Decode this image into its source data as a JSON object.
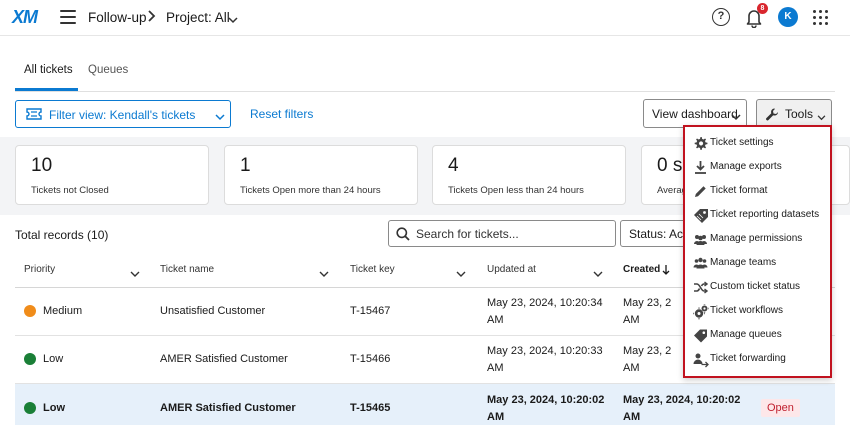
{
  "header": {
    "logo": "XM",
    "breadcrumb_app": "Follow-up",
    "breadcrumb_project": "Project: All",
    "notification_count": "8",
    "avatar_initial": "K"
  },
  "tabs": [
    {
      "label": "All tickets",
      "active": true
    },
    {
      "label": "Queues",
      "active": false
    }
  ],
  "filters": {
    "filter_view_label": "Filter view: Kendall's tickets",
    "reset_label": "Reset filters",
    "view_dashboard_label": "View dashboard",
    "tools_label": "Tools"
  },
  "stats": [
    {
      "value": "10",
      "label": "Tickets not Closed"
    },
    {
      "value": "1",
      "label": "Tickets Open more than 24 hours"
    },
    {
      "value": "4",
      "label": "Tickets Open less than 24 hours"
    },
    {
      "value": "0 s",
      "label": "Averag"
    }
  ],
  "records": {
    "total_label": "Total records (10)",
    "search_placeholder": "Search for tickets...",
    "status_filter": "Status: Activ"
  },
  "table": {
    "columns": [
      "Priority",
      "Ticket name",
      "Ticket key",
      "Updated at",
      "Created"
    ],
    "rows": [
      {
        "priority": "Medium",
        "priority_color": "#f08c1a",
        "name": "Unsatisfied Customer",
        "key": "T-15467",
        "updated_line1": "May 23, 2024, 10:20:34",
        "updated_line2": "AM",
        "created_line1": "May 23, 2",
        "created_line2": "AM",
        "selected": false
      },
      {
        "priority": "Low",
        "priority_color": "#1a7f37",
        "name": "AMER Satisfied Customer",
        "key": "T-15466",
        "updated_line1": "May 23, 2024, 10:20:33",
        "updated_line2": "AM",
        "created_line1": "May 23, 2",
        "created_line2": "AM",
        "selected": false
      },
      {
        "priority": "Low",
        "priority_color": "#1a7f37",
        "name": "AMER Satisfied Customer",
        "key": "T-15465",
        "updated_line1": "May 23, 2024, 10:20:02",
        "updated_line2": "AM",
        "created_line1": "May 23, 2024, 10:20:02",
        "created_line2": "AM",
        "selected": true,
        "status": "Open"
      }
    ]
  },
  "tools_menu": [
    {
      "label": "Ticket settings",
      "icon": "gear-icon"
    },
    {
      "label": "Manage exports",
      "icon": "download-icon"
    },
    {
      "label": "Ticket format",
      "icon": "pencil-icon"
    },
    {
      "label": "Ticket reporting datasets",
      "icon": "tag-icon"
    },
    {
      "label": "Manage permissions",
      "icon": "users-icon"
    },
    {
      "label": "Manage teams",
      "icon": "team-icon"
    },
    {
      "label": "Custom ticket status",
      "icon": "shuffle-icon"
    },
    {
      "label": "Ticket workflows",
      "icon": "gears-icon"
    },
    {
      "label": "Manage queues",
      "icon": "tags-icon"
    },
    {
      "label": "Ticket forwarding",
      "icon": "user-forward-icon"
    }
  ],
  "colors": {
    "accent": "#0b7ad1",
    "menu_highlight_border": "#c1121f",
    "selected_row": "#e6f0fa",
    "open_badge_bg": "#fde7e9",
    "open_badge_text": "#c01f2e"
  }
}
